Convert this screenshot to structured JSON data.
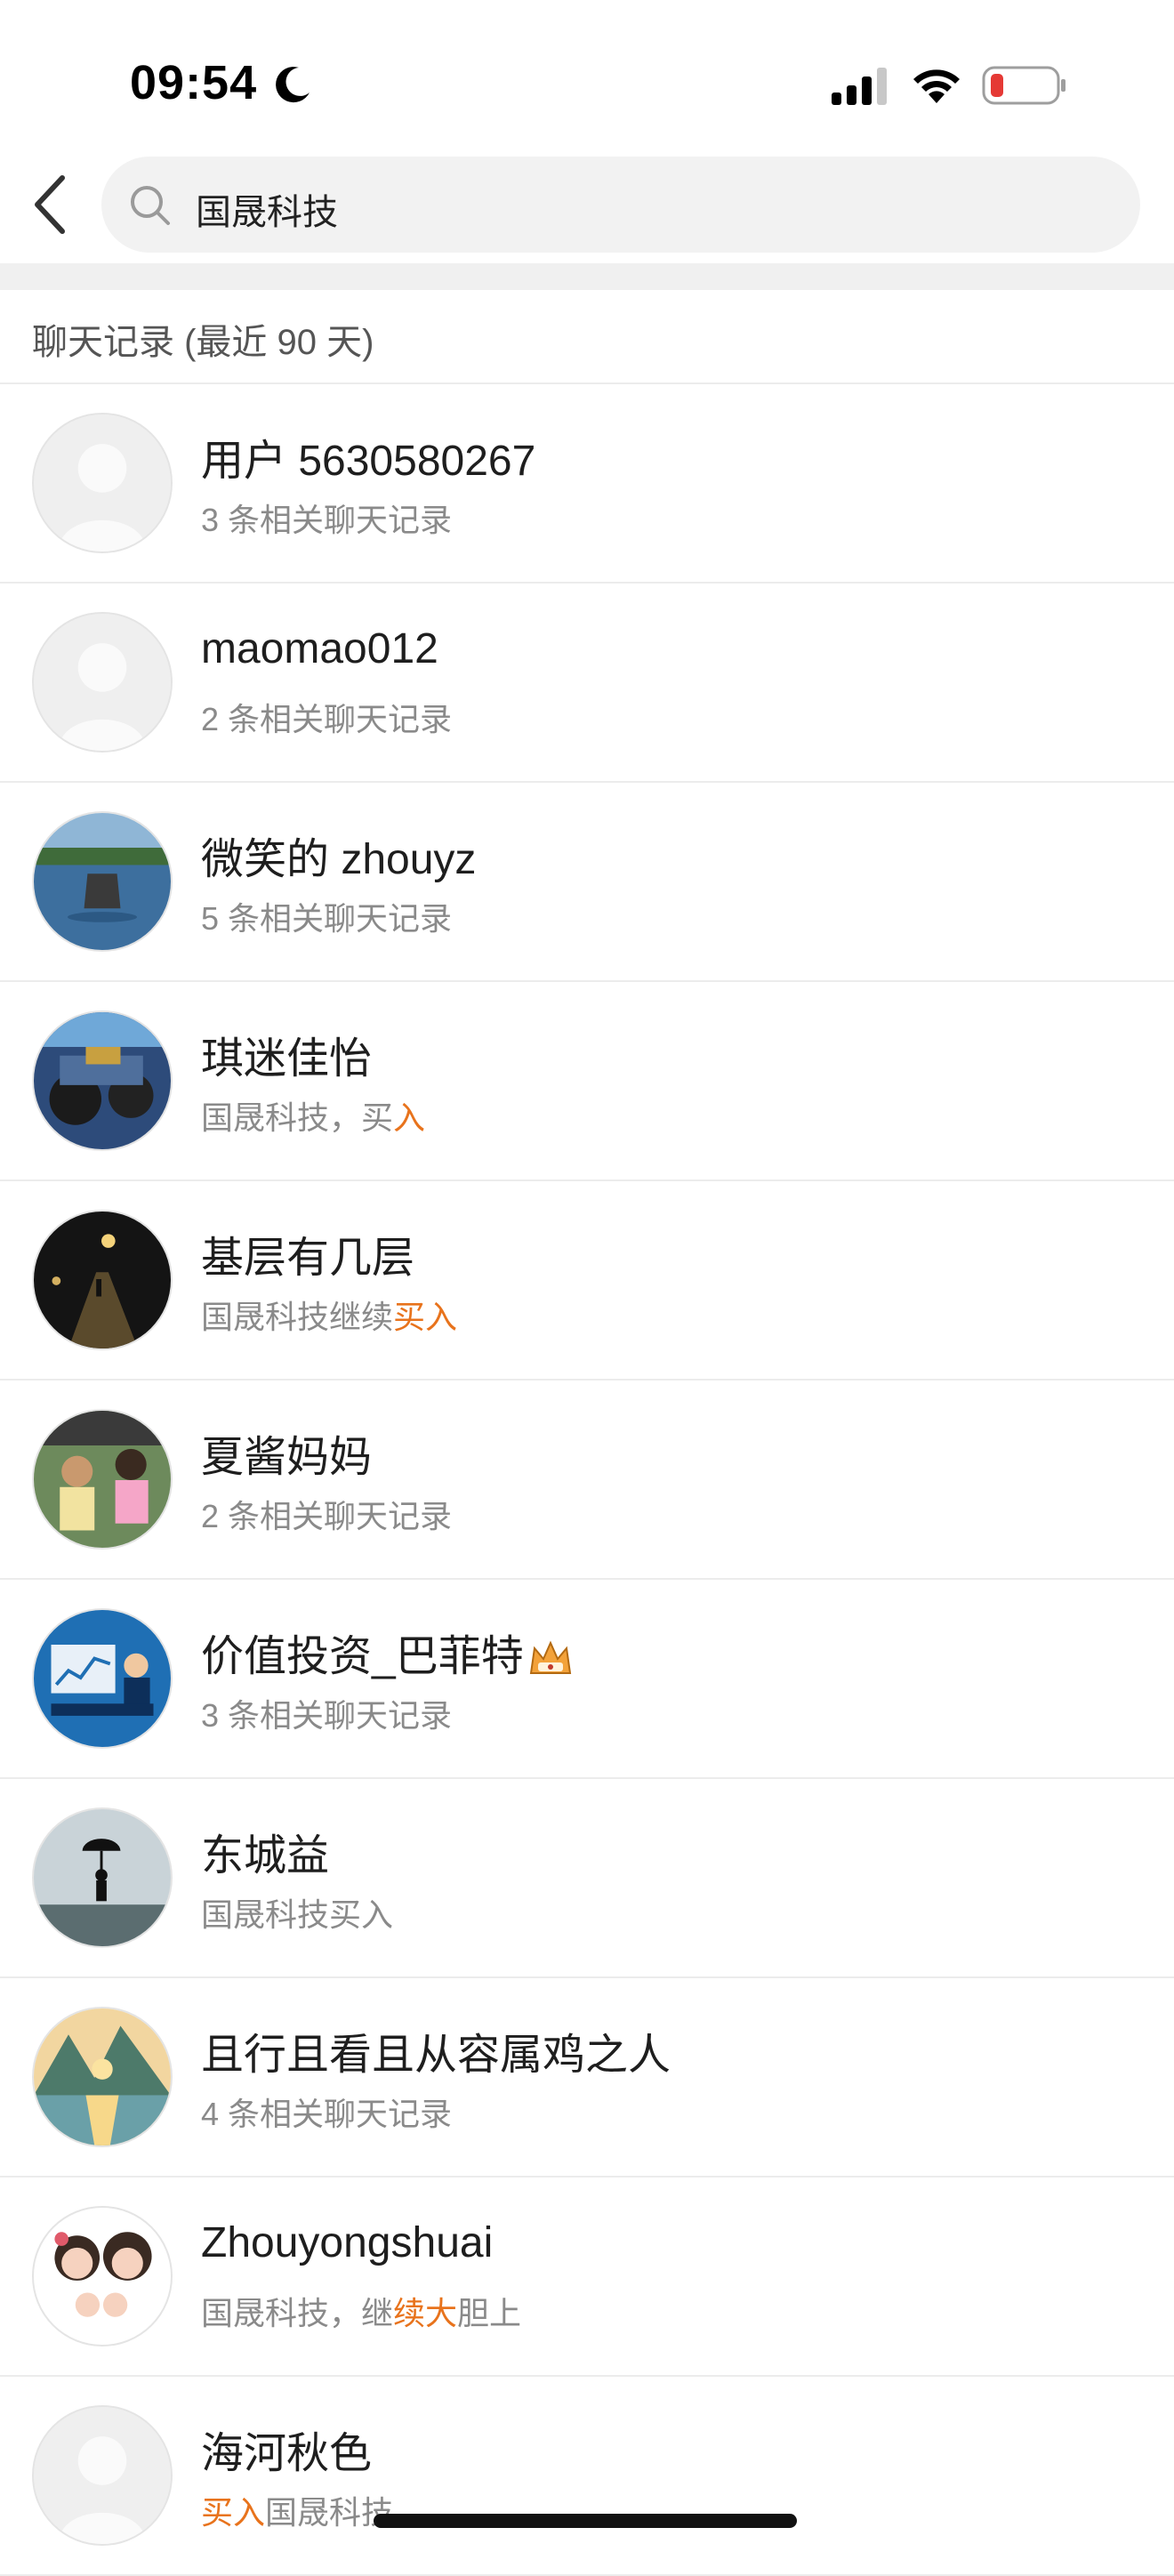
{
  "status_bar": {
    "time": "09:54"
  },
  "search": {
    "query": "国晟科技"
  },
  "section": {
    "title": "聊天记录 (最近 90 天)"
  },
  "colors": {
    "accent": "#e8731c",
    "battery_low": "#e53935"
  },
  "results": [
    {
      "name": "用户 5630580267",
      "sub": "3 条相关聊天记录",
      "avatar": "default-avatar"
    },
    {
      "name": "maomao012",
      "sub": "2 条相关聊天记录",
      "avatar": "default-avatar"
    },
    {
      "name": "微笑的 zhouyz",
      "sub": "5 条相关聊天记录",
      "avatar": "lake-rock-photo"
    },
    {
      "name": "琪迷佳怡",
      "sub_plain": "国晟科技，买",
      "sub_hl": "入",
      "avatar": "machinery-photo"
    },
    {
      "name": "基层有几层",
      "sub_plain": "国晟科技继续",
      "sub_hl": "买入",
      "avatar": "night-road-photo"
    },
    {
      "name": "夏酱妈妈",
      "sub": "2 条相关聊天记录",
      "avatar": "children-photo"
    },
    {
      "name": "价值投资_巴菲特",
      "sub": "3 条相关聊天记录",
      "avatar": "trader-illustration"
    },
    {
      "name": "东城益",
      "sub": "国晟科技买入",
      "avatar": "umbrella-figure-photo"
    },
    {
      "name": "且行且看且从容属鸡之人",
      "sub": "4 条相关聊天记录",
      "avatar": "mountain-lake-painting"
    },
    {
      "name": "Zhouyongshuai",
      "sub_pre": "国晟科技，继",
      "sub_hl": "续大",
      "sub_post": "胆上",
      "avatar": "family-cartoon"
    },
    {
      "name": "海河秋色",
      "sub_hl_first": "买入",
      "sub_after": "国晟科技",
      "avatar": "default-avatar"
    }
  ]
}
